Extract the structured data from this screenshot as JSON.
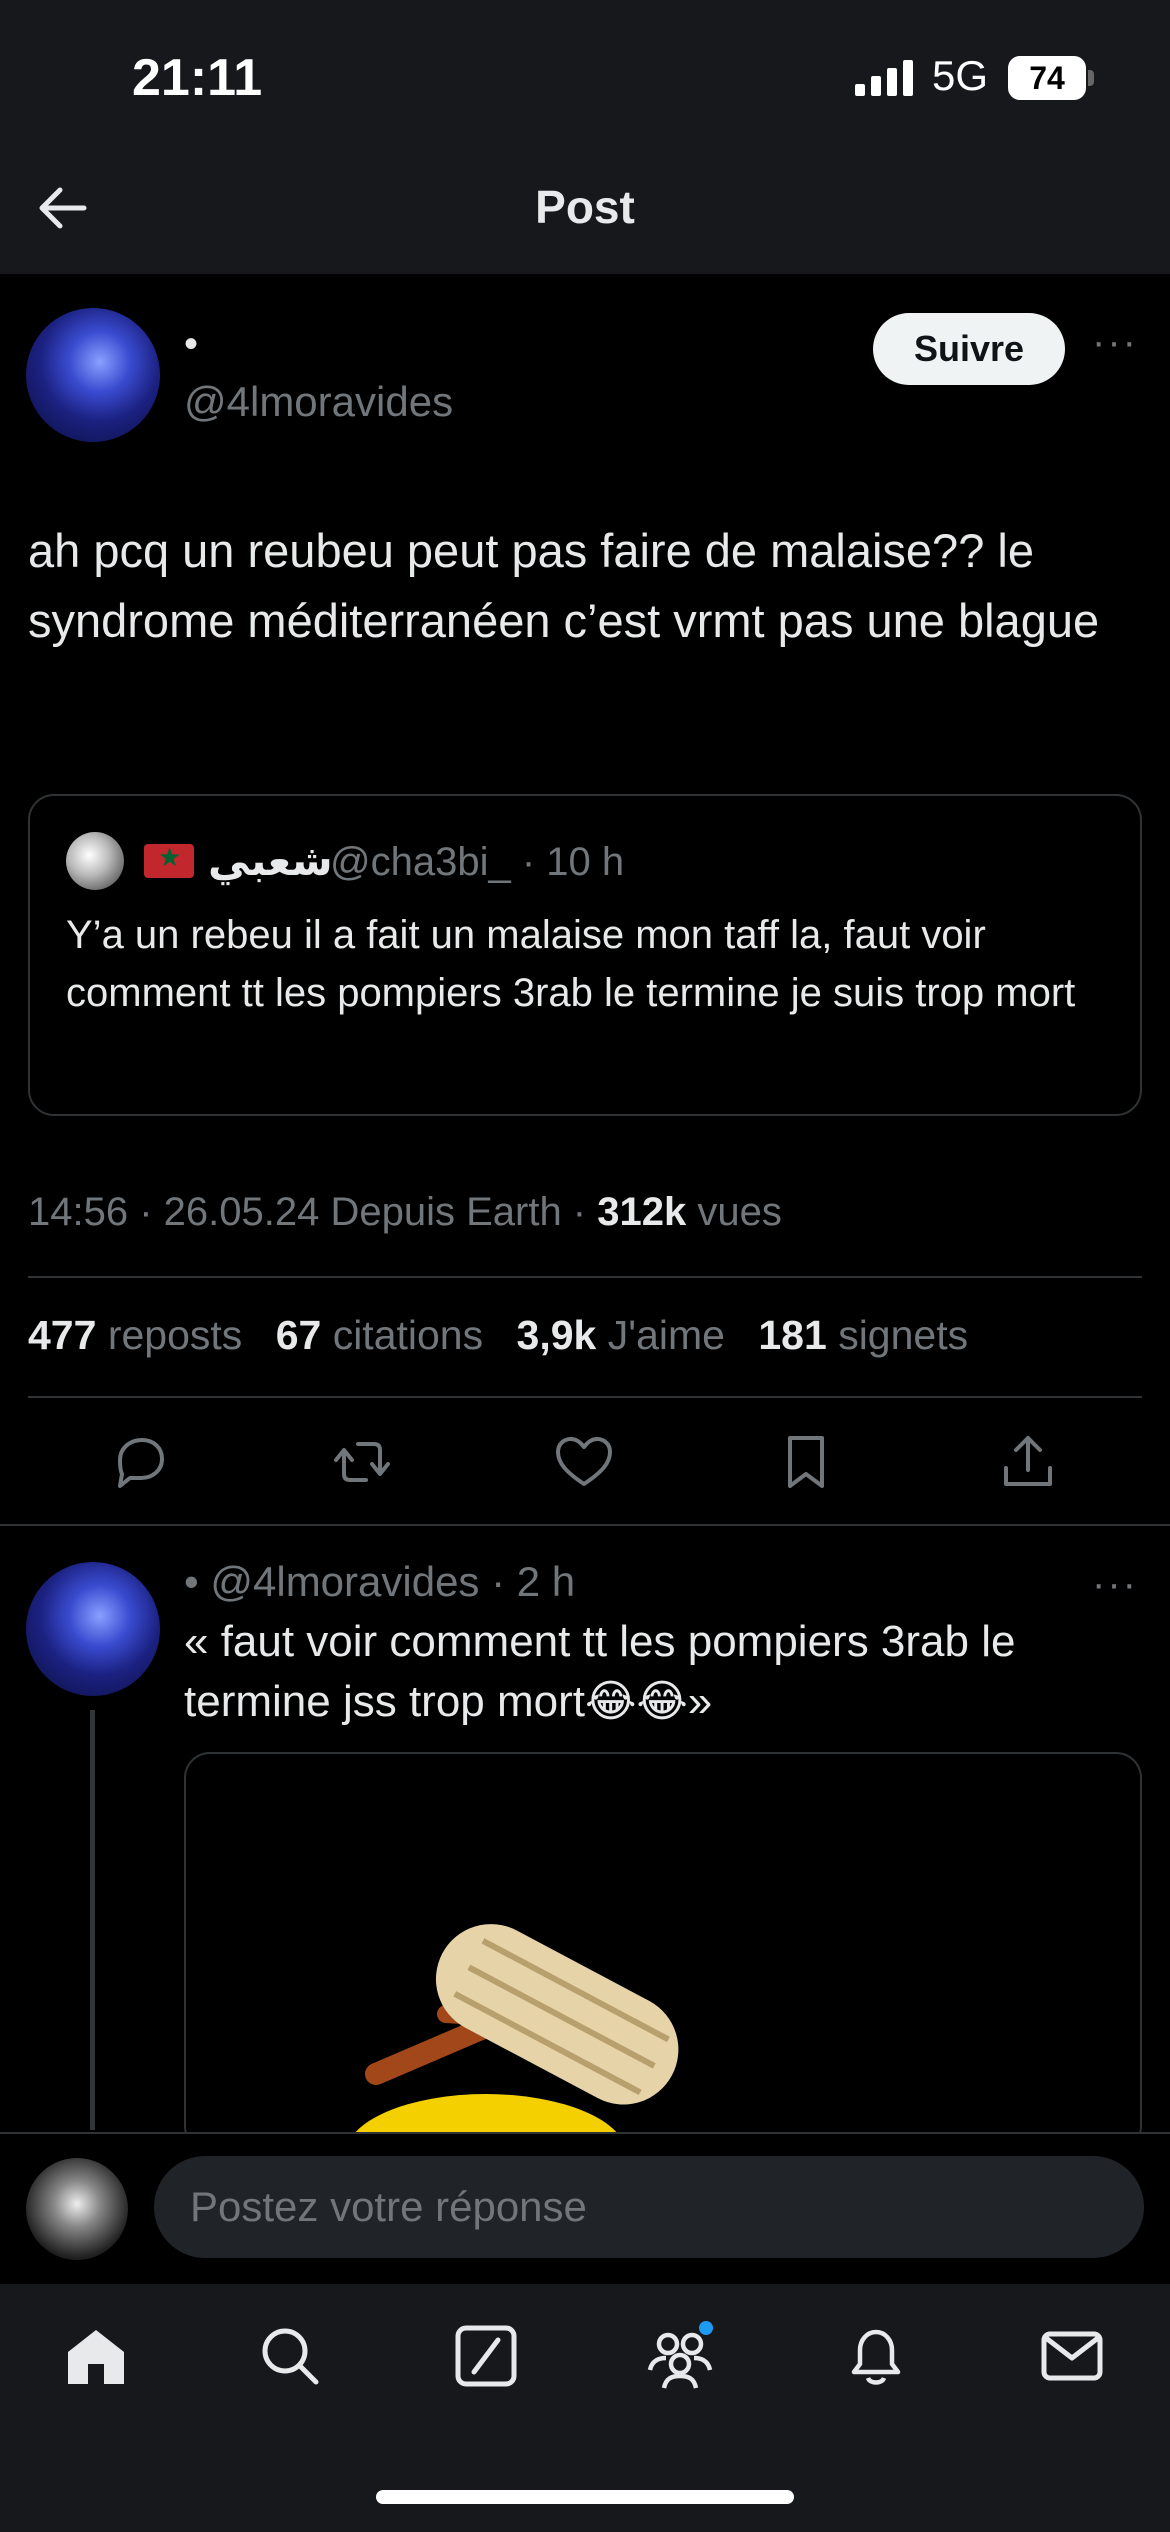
{
  "status_bar": {
    "time": "21:11",
    "network": "5G",
    "battery": "74"
  },
  "header": {
    "title": "Post",
    "back_icon": "back-arrow-icon"
  },
  "post": {
    "author_name": "•",
    "author_handle": "@4lmoravides",
    "follow_label": "Suivre",
    "more_icon": "···",
    "text": "ah pcq un reubeu peut pas faire de malaise?? le syndrome méditerranéen c’est vrmt pas une blague",
    "quote": {
      "name": "شعبي",
      "handle": "@cha3bi_ · 10 h",
      "text": "Y’a un rebeu il a fait un malaise  mon taff la, faut voir comment tt les pompiers 3rab le termine je suis trop mort"
    },
    "meta": {
      "time_date": "14:56 · 26.05.24 Depuis Earth · ",
      "views_count": "312k",
      "views_label": " vues"
    },
    "stats": {
      "reposts_count": "477",
      "reposts_label": "reposts",
      "quotes_count": "67",
      "quotes_label": "citations",
      "likes_count": "3,9k",
      "likes_label": "J'aime",
      "bookmarks_count": "181",
      "bookmarks_label": "signets"
    }
  },
  "reply": {
    "header": "• @4lmoravides · 2 h",
    "text": "« faut voir comment tt les pompiers 3rab le termine jss trop mort😂😂»"
  },
  "compose": {
    "placeholder": "Postez votre réponse"
  },
  "colors": {
    "background": "#000000",
    "bar": "#16181c",
    "text": "#e7e9ea",
    "muted": "#71767b",
    "divider": "#2f3336",
    "accent": "#1d9bf0"
  }
}
